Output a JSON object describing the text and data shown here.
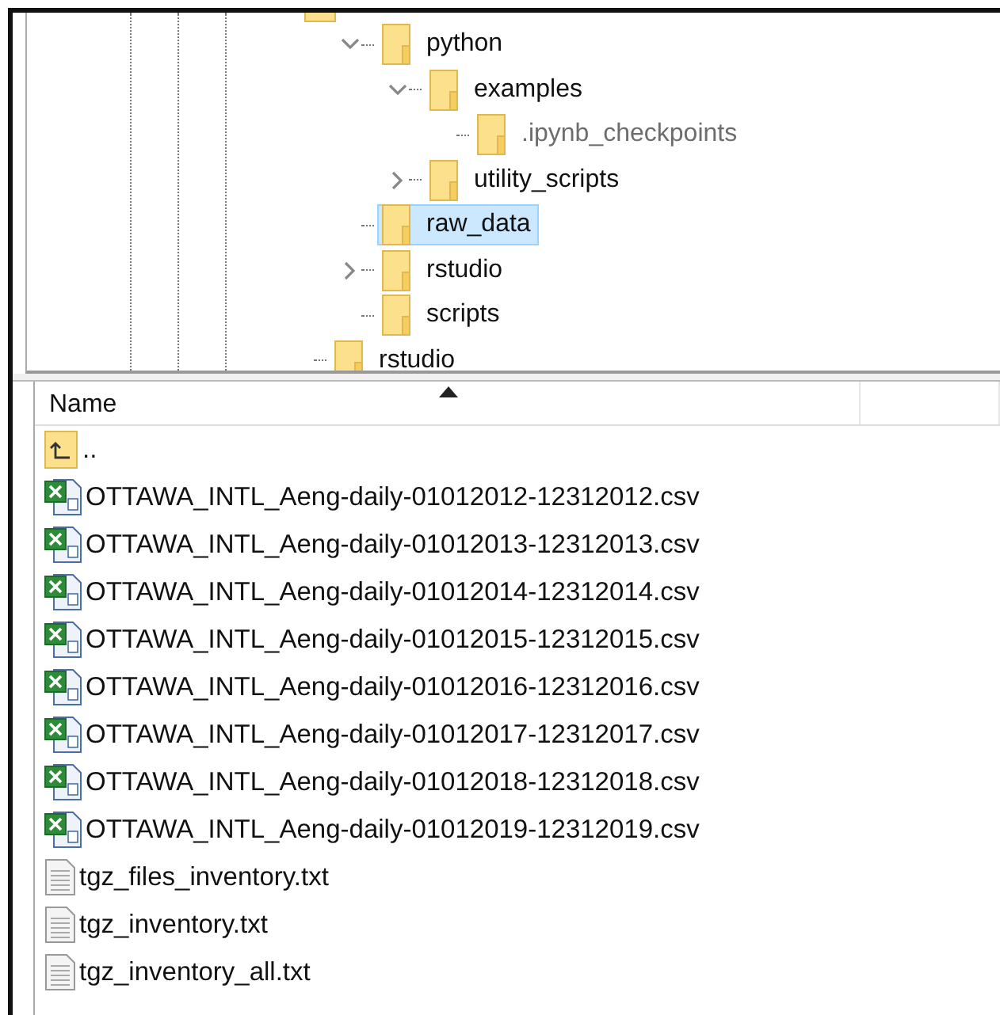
{
  "tree": {
    "items": [
      {
        "children": [
          {
            "label": "python",
            "expanded": true,
            "selected": false,
            "hidden": false,
            "children": [
              {
                "label": "examples",
                "expanded": true,
                "selected": false,
                "hidden": false,
                "children": [
                  {
                    "label": ".ipynb_checkpoints",
                    "selected": false,
                    "hidden": true
                  }
                ]
              },
              {
                "label": "utility_scripts",
                "expanded": false,
                "selected": false,
                "hidden": false
              }
            ]
          },
          {
            "label": "raw_data",
            "selected": true,
            "hidden": false
          },
          {
            "label": "rstudio",
            "expanded": false,
            "selected": false,
            "hidden": false
          },
          {
            "label": "scripts",
            "selected": false,
            "hidden": false
          }
        ]
      },
      {
        "label": "rstudio",
        "selected": false,
        "hidden": false
      }
    ]
  },
  "file_list": {
    "columns": [
      {
        "label": "Name",
        "sorted_ascending": true
      },
      {}
    ],
    "rows": [
      {
        "kind": "parent",
        "name": ".."
      },
      {
        "kind": "csv",
        "name": "OTTAWA_INTL_Aeng-daily-01012012-12312012.csv"
      },
      {
        "kind": "csv",
        "name": "OTTAWA_INTL_Aeng-daily-01012013-12312013.csv"
      },
      {
        "kind": "csv",
        "name": "OTTAWA_INTL_Aeng-daily-01012014-12312014.csv"
      },
      {
        "kind": "csv",
        "name": "OTTAWA_INTL_Aeng-daily-01012015-12312015.csv"
      },
      {
        "kind": "csv",
        "name": "OTTAWA_INTL_Aeng-daily-01012016-12312016.csv"
      },
      {
        "kind": "csv",
        "name": "OTTAWA_INTL_Aeng-daily-01012017-12312017.csv"
      },
      {
        "kind": "csv",
        "name": "OTTAWA_INTL_Aeng-daily-01012018-12312018.csv"
      },
      {
        "kind": "csv",
        "name": "OTTAWA_INTL_Aeng-daily-01012019-12312019.csv"
      },
      {
        "kind": "txt",
        "name": "tgz_files_inventory.txt"
      },
      {
        "kind": "txt",
        "name": "tgz_inventory.txt"
      },
      {
        "kind": "txt",
        "name": "tgz_inventory_all.txt"
      }
    ]
  }
}
